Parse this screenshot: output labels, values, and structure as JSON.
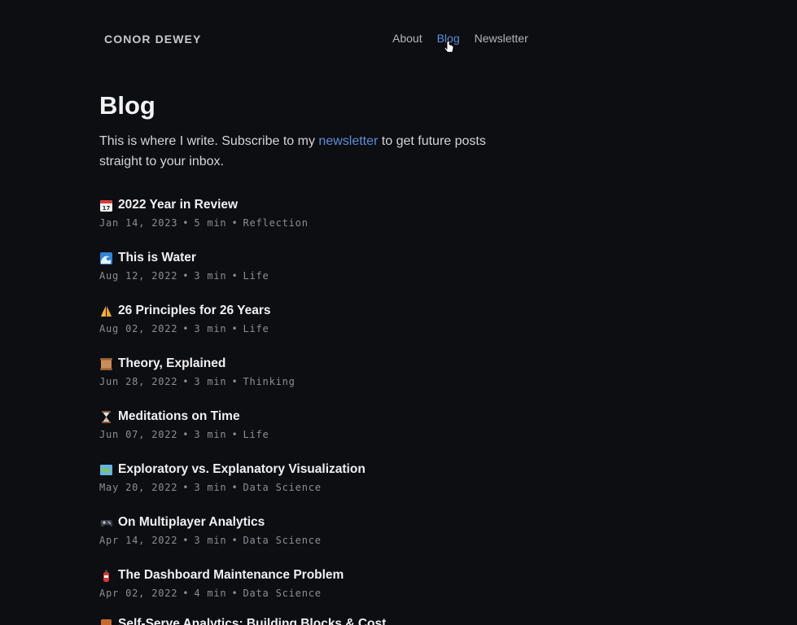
{
  "header": {
    "brand": "CONOR DEWEY",
    "nav": [
      {
        "label": "About",
        "active": false
      },
      {
        "label": "Blog",
        "active": true
      },
      {
        "label": "Newsletter",
        "active": false
      }
    ]
  },
  "main": {
    "title": "Blog",
    "intro_before": "This is where I write. Subscribe to my ",
    "intro_link": "newsletter",
    "intro_after": " to get future posts straight to your inbox."
  },
  "posts": [
    {
      "icon": "calendar-icon",
      "title": "2022 Year in Review",
      "date": "Jan 14, 2023",
      "read": "5 min",
      "category": "Reflection"
    },
    {
      "icon": "wave-icon",
      "title": "This is Water",
      "date": "Aug 12, 2022",
      "read": "3 min",
      "category": "Life"
    },
    {
      "icon": "folded-hands-icon",
      "title": "26 Principles for 26 Years",
      "date": "Aug 02, 2022",
      "read": "3 min",
      "category": "Life"
    },
    {
      "icon": "scroll-icon",
      "title": "Theory, Explained",
      "date": "Jun 28, 2022",
      "read": "3 min",
      "category": "Thinking"
    },
    {
      "icon": "hourglass-icon",
      "title": "Meditations on Time",
      "date": "Jun 07, 2022",
      "read": "3 min",
      "category": "Life"
    },
    {
      "icon": "map-icon",
      "title": "Exploratory vs. Explanatory Visualization",
      "date": "May 20, 2022",
      "read": "3 min",
      "category": "Data Science"
    },
    {
      "icon": "game-controller-icon",
      "title": "On Multiplayer Analytics",
      "date": "Apr 14, 2022",
      "read": "3 min",
      "category": "Data Science"
    },
    {
      "icon": "fire-extinguisher-icon",
      "title": "The Dashboard Maintenance Problem",
      "date": "Apr 02, 2022",
      "read": "4 min",
      "category": "Data Science"
    },
    {
      "icon": "book-icon",
      "title": "Self-Serve Analytics: Building Blocks & Cost",
      "date": "",
      "read": "",
      "category": ""
    }
  ],
  "meta_separator": "•"
}
